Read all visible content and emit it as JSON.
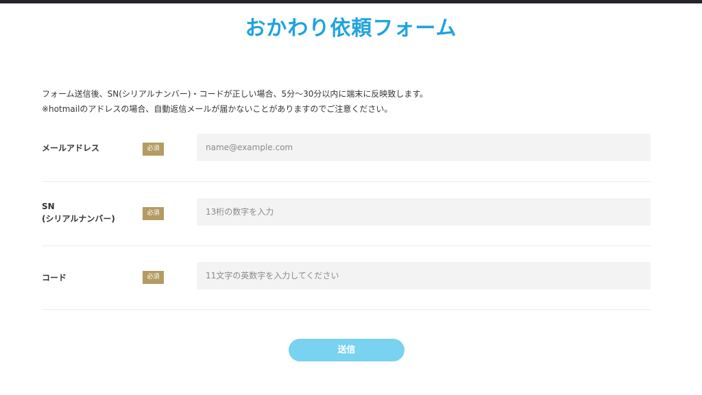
{
  "page": {
    "title": "おかわり依頼フォーム"
  },
  "notice": {
    "line1": "フォーム送信後、SN(シリアルナンバー)・コードが正しい場合、5分〜30分以内に端末に反映致します。",
    "line2": "※hotmailのアドレスの場合、自動返信メールが届かないことがありますのでご注意ください。"
  },
  "form": {
    "required_badge": "必須",
    "email": {
      "label": "メールアドレス",
      "placeholder": "name@example.com",
      "value": ""
    },
    "sn": {
      "label_line1": "SN",
      "label_line2": "(シリアルナンバー)",
      "placeholder": "13桁の数字を入力",
      "value": ""
    },
    "code": {
      "label": "コード",
      "placeholder": "11文字の英数字を入力してください",
      "value": ""
    },
    "submit_label": "送信"
  },
  "colors": {
    "title": "#1fa3df",
    "badge": "#b39b63",
    "submit": "#78d2f0",
    "field_background": "#f3f3f3",
    "top_bar": "#23252b"
  }
}
